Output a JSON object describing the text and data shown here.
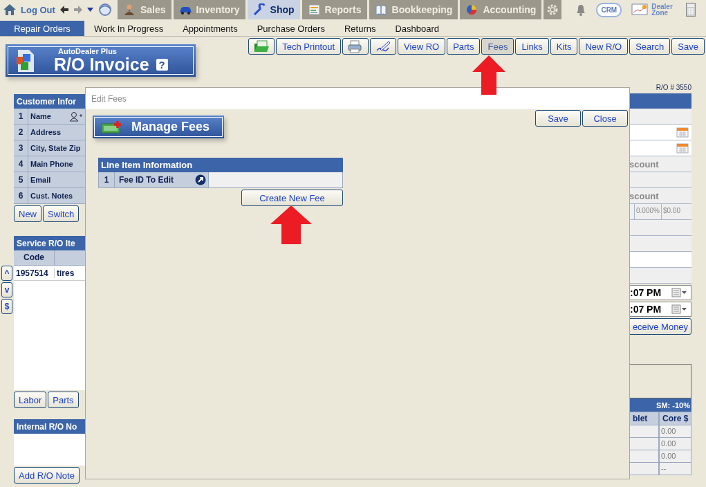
{
  "top_nav": {
    "logout": "Log Out",
    "tabs": [
      {
        "label": "Sales",
        "selected": false
      },
      {
        "label": "Inventory",
        "selected": false
      },
      {
        "label": "Shop",
        "selected": true
      },
      {
        "label": "Reports",
        "selected": false
      },
      {
        "label": "Bookkeeping",
        "selected": false
      },
      {
        "label": "Accounting",
        "selected": false
      }
    ],
    "crm": "CRM",
    "dealer_zone": "Dealer Zone"
  },
  "subnav": [
    {
      "label": "Repair Orders",
      "selected": true
    },
    {
      "label": "Work In Progress",
      "selected": false
    },
    {
      "label": "Appointments",
      "selected": false
    },
    {
      "label": "Purchase Orders",
      "selected": false
    },
    {
      "label": "Returns",
      "selected": false
    },
    {
      "label": "Dashboard",
      "selected": false
    }
  ],
  "logo": {
    "brand": "AutoDealer Plus",
    "title": "R/O Invoice",
    "help": "?"
  },
  "toolbar": [
    {
      "kind": "icon",
      "selected": false
    },
    {
      "kind": "text",
      "label": "Tech Printout",
      "selected": false
    },
    {
      "kind": "icon",
      "selected": false
    },
    {
      "kind": "icon",
      "selected": false
    },
    {
      "kind": "text",
      "label": "View RO",
      "selected": false
    },
    {
      "kind": "text",
      "label": "Parts",
      "selected": false
    },
    {
      "kind": "text",
      "label": "Fees",
      "selected": true
    },
    {
      "kind": "text",
      "label": "Links",
      "selected": false
    },
    {
      "kind": "text",
      "label": "Kits",
      "selected": false
    },
    {
      "kind": "text",
      "label": "New R/O",
      "selected": false
    },
    {
      "kind": "text",
      "label": "Search",
      "selected": false
    },
    {
      "kind": "text",
      "label": "Save",
      "selected": false
    }
  ],
  "side_buttons": [
    "^",
    "v",
    "$"
  ],
  "customer_info": {
    "title": "Customer Infor",
    "rows": [
      {
        "number": "1",
        "label": "Name"
      },
      {
        "number": "2",
        "label": "Address"
      },
      {
        "number": "3",
        "label": "City, State Zip"
      },
      {
        "number": "4",
        "label": "Main Phone"
      },
      {
        "number": "5",
        "label": "Email"
      },
      {
        "number": "6",
        "label": "Cust. Notes"
      }
    ],
    "buttons": [
      "New",
      "Switch"
    ]
  },
  "service_items": {
    "title": "Service R/O Ite",
    "columns": [
      "Code"
    ],
    "rows": [
      {
        "code": "1957514",
        "description": "tires"
      }
    ],
    "buttons": [
      "Labor",
      "Parts"
    ]
  },
  "internal_notes": {
    "title": "Internal R/O No",
    "buttons": [
      "Add R/O Note"
    ]
  },
  "right_panel": {
    "ro_number": "R/O # 3550",
    "rows": [
      {
        "kind": "blank"
      },
      {
        "kind": "date"
      },
      {
        "kind": "date"
      },
      {
        "kind": "label",
        "text": "scount"
      },
      {
        "kind": "blank"
      },
      {
        "kind": "label",
        "text": "scount"
      },
      {
        "kind": "values",
        "values": [
          "0.000%",
          "$0.00"
        ]
      },
      {
        "kind": "blank"
      },
      {
        "kind": "blank"
      },
      {
        "kind": "input"
      },
      {
        "kind": "blank"
      }
    ],
    "times": [
      ":07 PM",
      ":07 PM"
    ],
    "receive_button": "eceive Money",
    "summary_title": "SM: -10%",
    "columns": [
      "blet",
      "Core $"
    ],
    "core_values": [
      "0.00",
      "0.00",
      "0.00",
      "--"
    ]
  },
  "modal": {
    "title": "Edit Fees",
    "buttons": [
      "Save",
      "Close"
    ],
    "banner": "Manage Fees",
    "section": {
      "title": "Line Item Information",
      "rows": [
        {
          "number": "1",
          "label": "Fee ID To Edit"
        }
      ]
    },
    "create_button": "Create New Fee"
  }
}
